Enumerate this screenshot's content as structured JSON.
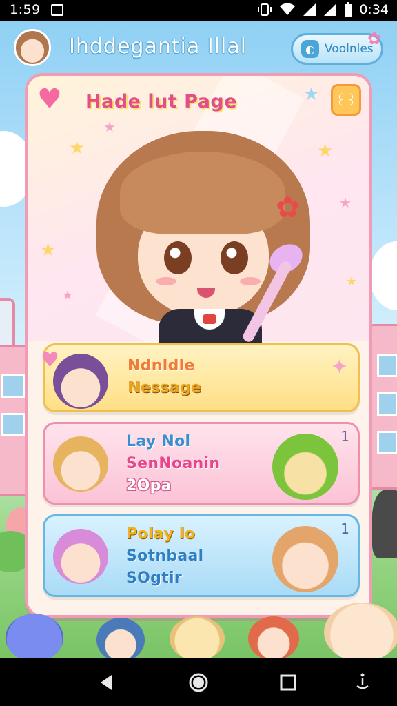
{
  "status_bar": {
    "time_left": "1:59",
    "time_right": "0:34",
    "icons": [
      "notification-icon",
      "vibrate-icon",
      "wifi-icon",
      "signal-icon",
      "signal-icon",
      "battery-icon"
    ]
  },
  "header": {
    "title": "Ihddegantia Illal",
    "pill_label": "Voolnles",
    "pill_icon": "chat-icon"
  },
  "hero": {
    "title": "Hade lut Page",
    "badge": "꒰꒱"
  },
  "items": [
    {
      "line1": "Ndnldle",
      "line2": "Nessage"
    },
    {
      "line1": "Lay  Nol",
      "line2": "SenNoanin",
      "line3": "2Opa",
      "count": "1"
    },
    {
      "line1": "Polay lo",
      "line2": "Sotnbaal",
      "line3": "SOgtir",
      "count": "1"
    }
  ],
  "colors": {
    "card_border": "#f29bb7",
    "accent_pink": "#e04f8c",
    "accent_blue": "#2f7fc4",
    "accent_yellow": "#f1b21a"
  }
}
